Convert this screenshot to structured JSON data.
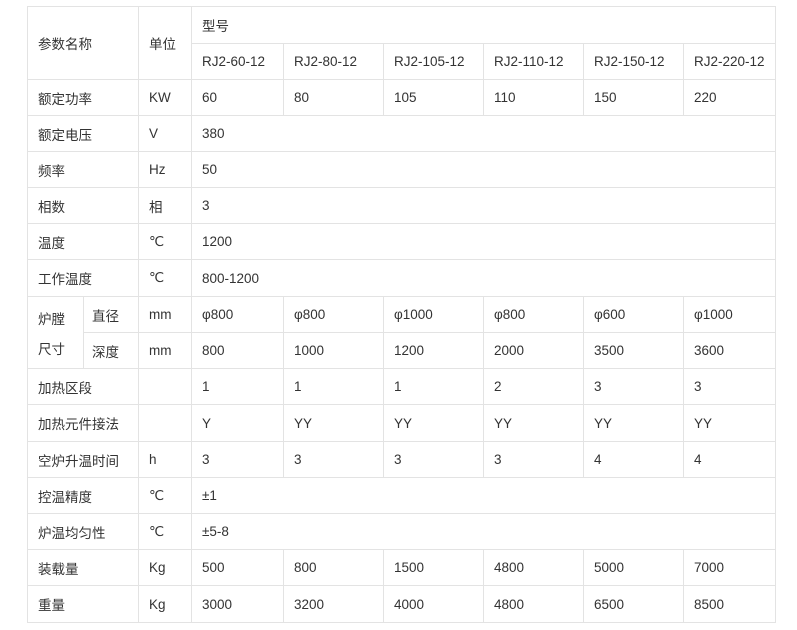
{
  "header": {
    "param_name": "参数名称",
    "unit": "单位",
    "model": "型号",
    "models": [
      "RJ2-60-12",
      "RJ2-80-12",
      "RJ2-105-12",
      "RJ2-110-12",
      "RJ2-150-12",
      "RJ2-220-12"
    ]
  },
  "rows": [
    {
      "label": "额定功率",
      "unit": "KW",
      "values": [
        "60",
        "80",
        "105",
        "110",
        "150",
        "220"
      ]
    },
    {
      "label": "额定电压",
      "unit": "V",
      "value": "380"
    },
    {
      "label": "频率",
      "unit": "Hz",
      "value": "50"
    },
    {
      "label": "相数",
      "unit": "相",
      "value": "3"
    },
    {
      "label": "温度",
      "unit": "℃",
      "value": "1200"
    },
    {
      "label": "工作温度",
      "unit": "℃",
      "value": "800-1200"
    },
    {
      "label": "加热区段",
      "unit": "",
      "values": [
        "1",
        "1",
        "1",
        "2",
        "3",
        "3"
      ]
    },
    {
      "label": "加热元件接法",
      "unit": "",
      "values": [
        "Y",
        "YY",
        "YY",
        "YY",
        "YY",
        "YY"
      ]
    },
    {
      "label": "空炉升温时间",
      "unit": "h",
      "values": [
        "3",
        "3",
        "3",
        "3",
        "4",
        "4"
      ]
    },
    {
      "label": "控温精度",
      "unit": "℃",
      "value": "±1"
    },
    {
      "label": "炉温均匀性",
      "unit": "℃",
      "value": "±5-8"
    },
    {
      "label": "装载量",
      "unit": "Kg",
      "values": [
        "500",
        "800",
        "1500",
        "4800",
        "5000",
        "7000"
      ]
    },
    {
      "label": "重量",
      "unit": "Kg",
      "values": [
        "3000",
        "3200",
        "4000",
        "4800",
        "6500",
        "8500"
      ]
    }
  ],
  "chamber": {
    "label_line1": "炉膛",
    "label_line2": "尺寸",
    "diameter": {
      "label": "直径",
      "unit": "mm",
      "values": [
        "φ800",
        "φ800",
        "φ1000",
        "φ800",
        "φ600",
        "φ1000"
      ]
    },
    "depth": {
      "label": "深度",
      "unit": "mm",
      "values": [
        "800",
        "1000",
        "1200",
        "2000",
        "3500",
        "3600"
      ]
    }
  }
}
